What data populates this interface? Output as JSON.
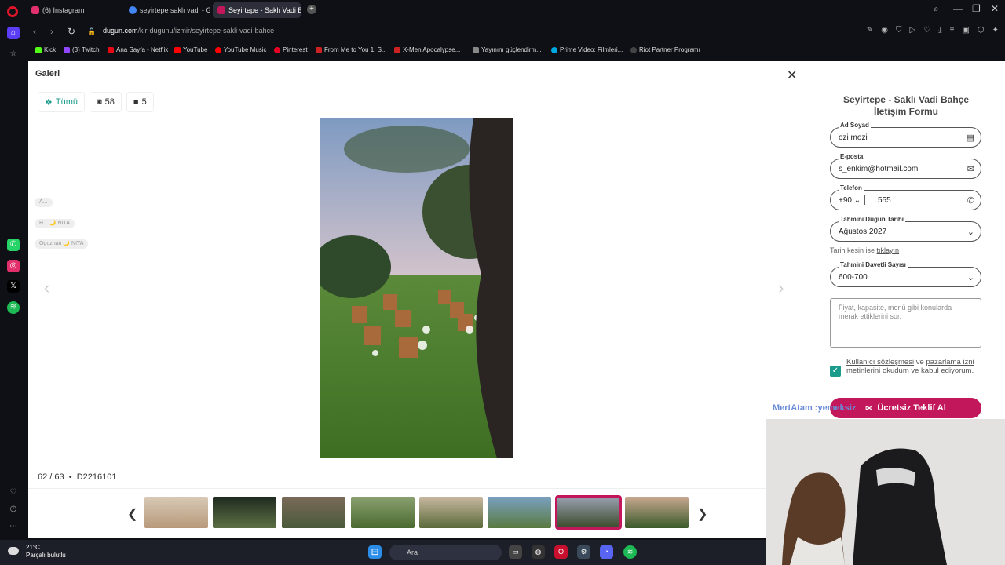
{
  "browser": {
    "tabs": [
      {
        "label": "(6) Instagram",
        "color": "#e1306c"
      },
      {
        "label": "seyirtepe saklı vadi - Goo",
        "color": "#4285f4"
      },
      {
        "label": "Seyirtepe - Saklı Vadi Bah",
        "color": "#c2185b"
      }
    ],
    "new_tab": "+",
    "url_domain": "dugun.com",
    "url_path": "/kir-dugunu/izmir/seyirtepe-sakli-vadi-bahce",
    "bookmarks": [
      {
        "label": "Kick",
        "color": "#53fc18"
      },
      {
        "label": "(3) Twitch",
        "color": "#9146ff"
      },
      {
        "label": "Ana Sayfa - Netflix",
        "color": "#e50914"
      },
      {
        "label": "YouTube",
        "color": "#ff0000"
      },
      {
        "label": "YouTube Music",
        "color": "#ff0000"
      },
      {
        "label": "Pinterest",
        "color": "#e60023"
      },
      {
        "label": "From Me to You 1. S...",
        "color": "#cc2222"
      },
      {
        "label": "X-Men Apocalypse...",
        "color": "#cc2222"
      },
      {
        "label": "Yayınını güçlendirm...",
        "color": "#888888"
      },
      {
        "label": "Prime Video: Filmleri...",
        "color": "#00a8e1"
      },
      {
        "label": "Riot Partner Programı",
        "color": "#444444"
      }
    ]
  },
  "gallery": {
    "title": "Galeri",
    "close": "✕",
    "filters": [
      {
        "label": "Tümü",
        "icon": "layers-icon"
      },
      {
        "label": "58",
        "icon": "camera-icon"
      },
      {
        "label": "5",
        "icon": "video-icon"
      }
    ],
    "counter": "62 / 63",
    "photo_id": "D2216101",
    "prev": "‹",
    "next": "›"
  },
  "chat_overlay": [
    {
      "label": "A..."
    },
    {
      "label": "H... 🌙 NITA"
    },
    {
      "label": "Oguzhan 🌙 NITA"
    }
  ],
  "form": {
    "title": "Seyirtepe - Saklı Vadi Bahçe İletişim Formu",
    "name_label": "Ad Soyad",
    "name_value": "ozi mozi",
    "email_label": "E-posta",
    "email_value": "s_enkim@hotmail.com",
    "phone_label": "Telefon",
    "phone_code": "+90",
    "phone_value": "555",
    "date_label": "Tahmini Düğün Tarihi",
    "date_value": "Ağustos 2027",
    "hint_prefix": "Tarih kesin ise",
    "hint_link": "tıklayın",
    "guests_label": "Tahmini Davetli Sayısı",
    "guests_value": "600-700",
    "message_placeholder": "Fiyat, kapasite, menü gibi konularda merak ettiklerini sor.",
    "consent_link1": "Kullanıcı sözleşmesi",
    "consent_and": "ve",
    "consent_link2": "pazarlama izni metinlerini",
    "consent_rest": "okudum ve kabul ediyorum.",
    "submit": "Ücretsiz Teklif Al"
  },
  "stream_overlay": "MertAtam :yemeksiz",
  "taskbar": {
    "temp": "21°C",
    "weather": "Parçalı bulutlu",
    "search": "Ara"
  }
}
